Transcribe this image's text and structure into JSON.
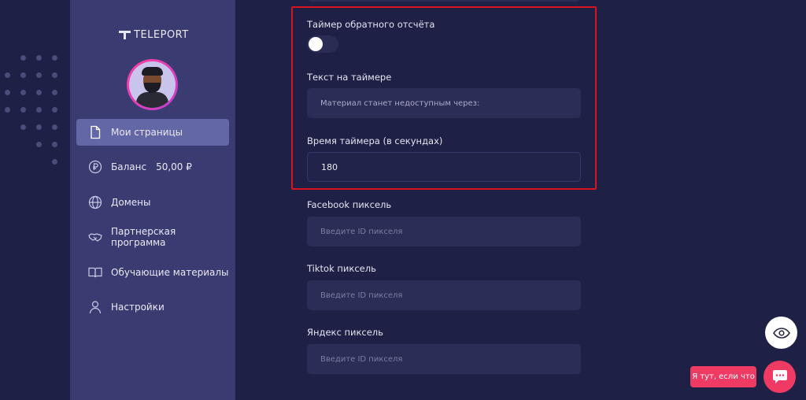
{
  "app": {
    "brand": "TELEPORT"
  },
  "sidebar": {
    "items": [
      {
        "label": "Мои страницы",
        "icon": "document-icon",
        "active": true
      },
      {
        "label": "Баланс",
        "value": "50,00 ₽",
        "icon": "ruble-icon"
      },
      {
        "label": "Домены",
        "icon": "globe-icon"
      },
      {
        "label": "Партнерская программа",
        "icon": "handshake-icon"
      },
      {
        "label": "Обучающие материалы",
        "icon": "book-icon"
      },
      {
        "label": "Настройки",
        "icon": "user-icon"
      }
    ]
  },
  "form": {
    "timer_toggle": {
      "label": "Таймер обратного отсчёта",
      "enabled": false
    },
    "timer_text": {
      "label": "Текст на таймере",
      "value": "Материал станет недоступным через:"
    },
    "timer_seconds": {
      "label": "Время таймера (в секундах)",
      "value": "180"
    },
    "facebook_pixel": {
      "label": "Facebook пиксель",
      "placeholder": "Введите ID пикселя"
    },
    "tiktok_pixel": {
      "label": "Tiktok пиксель",
      "placeholder": "Введите ID пикселя"
    },
    "yandex_pixel": {
      "label": "Яндекс пиксель",
      "placeholder": "Введите ID пикселя"
    }
  },
  "widgets": {
    "preview_icon": "eye-icon",
    "chat_tooltip": "Я тут, если что",
    "chat_icon": "chat-icon"
  },
  "colors": {
    "background": "#1e2046",
    "sidebar": "#3a3b71",
    "active_nav": "#6467a6",
    "field": "#2b2d57",
    "highlight_border": "#d8141f",
    "chat_accent": "#ef3a63"
  }
}
